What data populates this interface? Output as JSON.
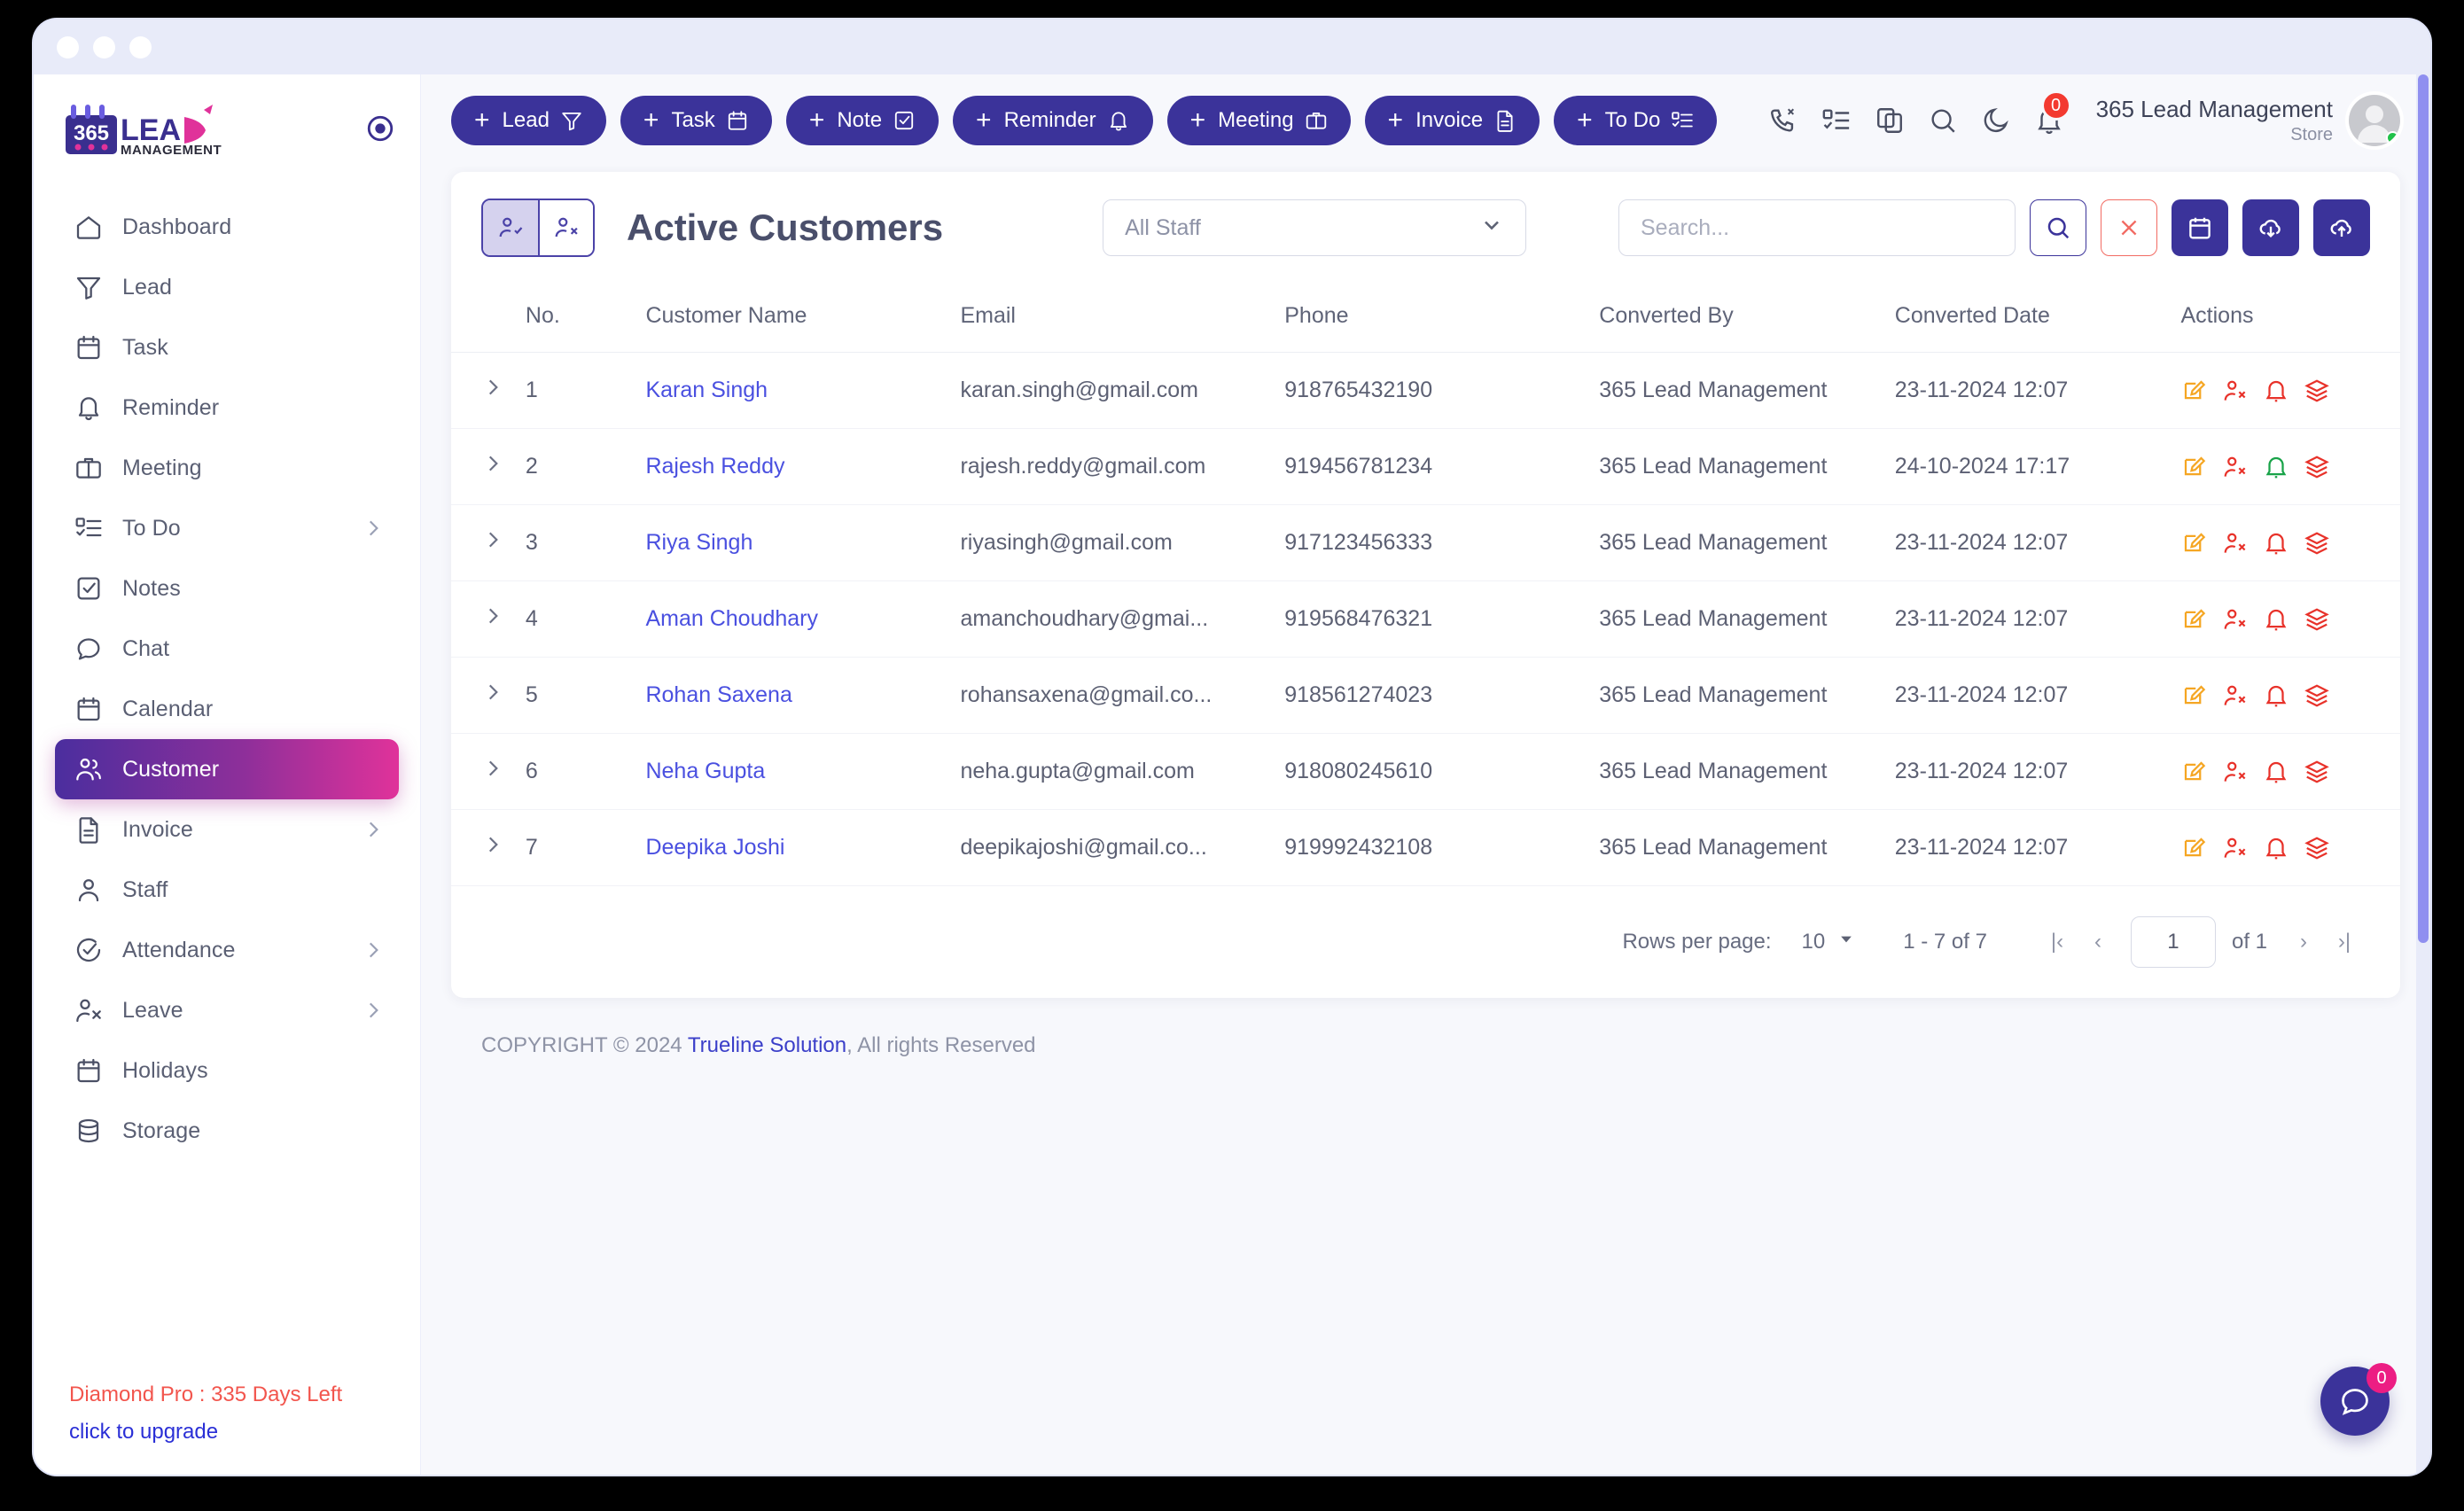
{
  "window": {
    "dots": [
      "close",
      "minimize",
      "maximize"
    ]
  },
  "brand": {
    "logo_365": "365",
    "logo_lead": "LEAD",
    "logo_management": "MANAGEMENT"
  },
  "sidebar": {
    "collapse_icon": "target-circle-icon",
    "items": [
      {
        "label": "Dashboard",
        "icon": "home-icon",
        "expandable": false,
        "active": false
      },
      {
        "label": "Lead",
        "icon": "funnel-icon",
        "expandable": false,
        "active": false
      },
      {
        "label": "Task",
        "icon": "calendar-icon",
        "expandable": false,
        "active": false
      },
      {
        "label": "Reminder",
        "icon": "bell-icon",
        "expandable": false,
        "active": false
      },
      {
        "label": "Meeting",
        "icon": "briefcase-icon",
        "expandable": false,
        "active": false
      },
      {
        "label": "To Do",
        "icon": "checklist-icon",
        "expandable": true,
        "active": false
      },
      {
        "label": "Notes",
        "icon": "note-check-icon",
        "expandable": false,
        "active": false
      },
      {
        "label": "Chat",
        "icon": "chat-bubble-icon",
        "expandable": false,
        "active": false
      },
      {
        "label": "Calendar",
        "icon": "calendar-icon",
        "expandable": false,
        "active": false
      },
      {
        "label": "Customer",
        "icon": "users-icon",
        "expandable": false,
        "active": true
      },
      {
        "label": "Invoice",
        "icon": "document-icon",
        "expandable": true,
        "active": false
      },
      {
        "label": "Staff",
        "icon": "user-icon",
        "expandable": false,
        "active": false
      },
      {
        "label": "Attendance",
        "icon": "check-circle-icon",
        "expandable": true,
        "active": false
      },
      {
        "label": "Leave",
        "icon": "user-x-icon",
        "expandable": true,
        "active": false
      },
      {
        "label": "Holidays",
        "icon": "calendar-icon",
        "expandable": false,
        "active": false
      },
      {
        "label": "Storage",
        "icon": "database-icon",
        "expandable": false,
        "active": false
      }
    ],
    "upgrade": {
      "plan_text": "Diamond Pro : 335 Days Left",
      "link_text": "click to upgrade"
    }
  },
  "topbar": {
    "quick_add": [
      {
        "label": "Lead",
        "icon": "funnel-icon"
      },
      {
        "label": "Task",
        "icon": "calendar-icon"
      },
      {
        "label": "Note",
        "icon": "note-check-icon"
      },
      {
        "label": "Reminder",
        "icon": "bell-icon"
      },
      {
        "label": "Meeting",
        "icon": "briefcase-icon"
      },
      {
        "label": "Invoice",
        "icon": "document-icon"
      },
      {
        "label": "To Do",
        "icon": "checklist-icon"
      }
    ],
    "plus_glyph": "+",
    "icons": [
      {
        "name": "missed-call-icon"
      },
      {
        "name": "checklist-icon"
      },
      {
        "name": "copy-icon"
      },
      {
        "name": "search-icon"
      },
      {
        "name": "moon-icon"
      }
    ],
    "notification": {
      "icon": "bell-icon",
      "count": "0"
    },
    "user": {
      "name": "365 Lead Management",
      "role": "Store",
      "status": "online"
    }
  },
  "card": {
    "toggle": [
      {
        "name": "active-customers-toggle",
        "icon": "user-check-icon",
        "selected": true
      },
      {
        "name": "inactive-customers-toggle",
        "icon": "user-x-icon",
        "selected": false
      }
    ],
    "title": "Active Customers",
    "staff_filter": {
      "value": "All Staff",
      "chevron": "chevron-down-icon"
    },
    "search": {
      "placeholder": "Search...",
      "value": ""
    },
    "buttons": [
      {
        "name": "search-button",
        "icon": "search-icon",
        "style": "outline-purple"
      },
      {
        "name": "clear-button",
        "icon": "close-icon",
        "style": "outline-red",
        "glyph": "✕"
      },
      {
        "name": "calendar-button",
        "icon": "calendar-icon",
        "style": "solid"
      },
      {
        "name": "download-button",
        "icon": "cloud-download-icon",
        "style": "solid"
      },
      {
        "name": "upload-button",
        "icon": "cloud-upload-icon",
        "style": "solid"
      }
    ]
  },
  "table": {
    "columns": [
      "No.",
      "Customer Name",
      "Email",
      "Phone",
      "Converted By",
      "Converted Date",
      "Actions"
    ],
    "rows": [
      {
        "no": "1",
        "name": "Karan Singh",
        "email": "karan.singh@gmail.com",
        "phone": "918765432190",
        "converted_by": "365 Lead Management",
        "converted_date": "23-11-2024 12:07",
        "bell_color": "#e8322a"
      },
      {
        "no": "2",
        "name": "Rajesh Reddy",
        "email": "rajesh.reddy@gmail.com",
        "phone": "919456781234",
        "converted_by": "365 Lead Management",
        "converted_date": "24-10-2024 17:17",
        "bell_color": "#19a349"
      },
      {
        "no": "3",
        "name": "Riya Singh",
        "email": "riyasingh@gmail.com",
        "phone": "917123456333",
        "converted_by": "365 Lead Management",
        "converted_date": "23-11-2024 12:07",
        "bell_color": "#e8322a"
      },
      {
        "no": "4",
        "name": "Aman Choudhary",
        "email": "amanchoudhary@gmai...",
        "phone": "919568476321",
        "converted_by": "365 Lead Management",
        "converted_date": "23-11-2024 12:07",
        "bell_color": "#e8322a"
      },
      {
        "no": "5",
        "name": "Rohan Saxena",
        "email": "rohansaxena@gmail.co...",
        "phone": "918561274023",
        "converted_by": "365 Lead Management",
        "converted_date": "23-11-2024 12:07",
        "bell_color": "#e8322a"
      },
      {
        "no": "6",
        "name": "Neha Gupta",
        "email": "neha.gupta@gmail.com",
        "phone": "918080245610",
        "converted_by": "365 Lead Management",
        "converted_date": "23-11-2024 12:07",
        "bell_color": "#e8322a"
      },
      {
        "no": "7",
        "name": "Deepika Joshi",
        "email": "deepikajoshi@gmail.co...",
        "phone": "919992432108",
        "converted_by": "365 Lead Management",
        "converted_date": "23-11-2024 12:07",
        "bell_color": "#e8322a"
      }
    ],
    "row_action_icons": [
      "edit-icon",
      "user-remove-icon",
      "bell-icon",
      "layers-icon"
    ]
  },
  "pagination": {
    "rows_per_page_label": "Rows per page:",
    "rows_per_page_value": "10",
    "range": "1 - 7 of 7",
    "page_value": "1",
    "of_label": "of 1",
    "first_glyph": "|‹",
    "prev_glyph": "‹",
    "next_glyph": "›",
    "last_glyph": "›|"
  },
  "footer": {
    "prefix": "COPYRIGHT © 2024 ",
    "company": "Trueline Solution",
    "suffix": ", All rights Reserved"
  },
  "chat_fab": {
    "icon": "chat-bubble-icon",
    "badge": "0"
  },
  "colors": {
    "primary": "#3b339a",
    "accent_pink": "#e0329a",
    "link": "#4a50e0",
    "danger": "#e8322a",
    "success": "#19a349",
    "edit": "#f5a623"
  }
}
